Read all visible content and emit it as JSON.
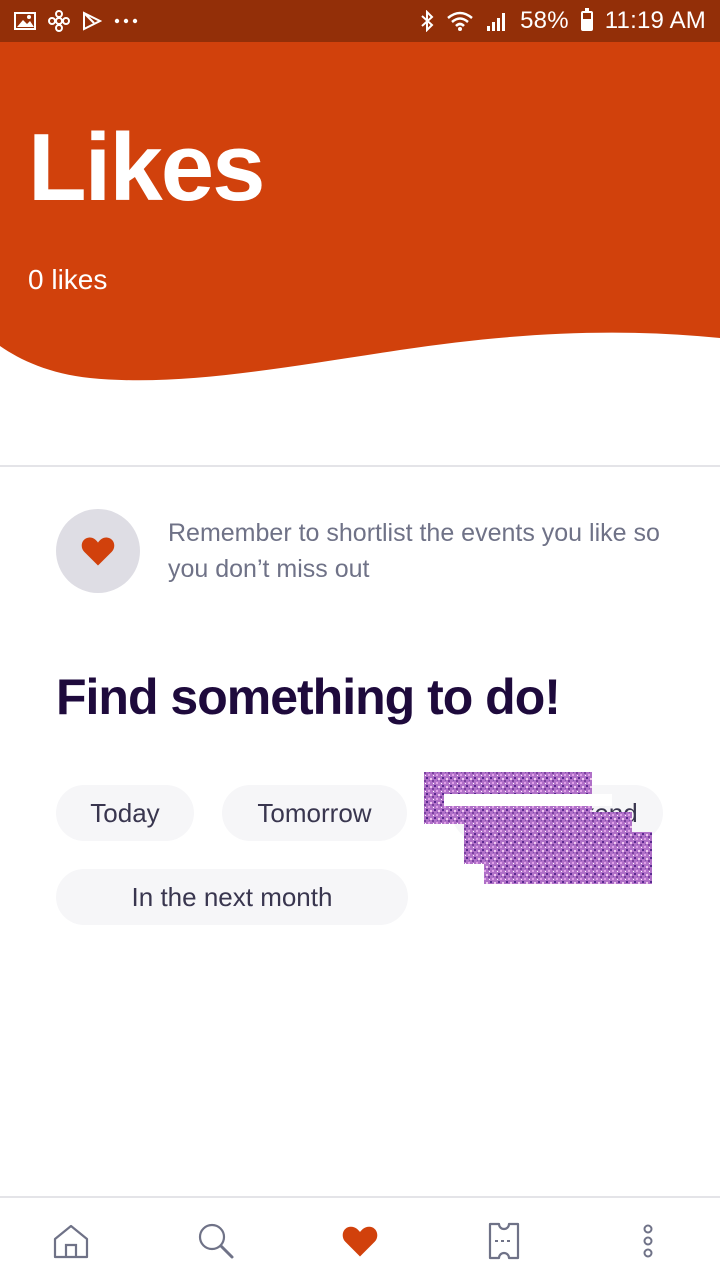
{
  "status_bar": {
    "battery": "58%",
    "time": "11:19 AM",
    "left_icons": [
      "gallery-icon",
      "fan-icon",
      "play-store-icon",
      "more-dots-icon"
    ],
    "right_icons": [
      "bluetooth-icon",
      "wifi-icon",
      "signal-icon",
      "battery-icon"
    ],
    "color": "#932f08"
  },
  "header": {
    "title": "Likes",
    "likes_count": "0 likes",
    "color": "#d1410c"
  },
  "reminder": {
    "text": "Remember to shortlist the events you like so you don’t miss out",
    "icon": "heart-icon"
  },
  "section": {
    "title": "Find something to do!",
    "chips": [
      {
        "label": "Today"
      },
      {
        "label": "Tomorrow"
      },
      {
        "label": "This weekend"
      },
      {
        "label": "In the next month"
      }
    ]
  },
  "bottom_nav": {
    "items": [
      {
        "icon": "home-icon",
        "active": false
      },
      {
        "icon": "search-icon",
        "active": false
      },
      {
        "icon": "heart-icon",
        "active": true
      },
      {
        "icon": "ticket-icon",
        "active": false
      },
      {
        "icon": "more-vertical-icon",
        "active": false
      }
    ],
    "active_color": "#d1410c",
    "inactive_color": "#6f7287"
  }
}
